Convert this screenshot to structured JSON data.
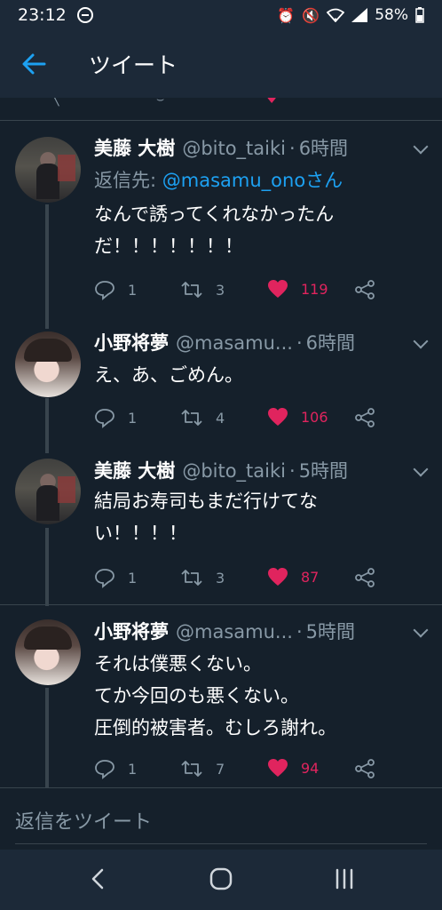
{
  "status_bar": {
    "time": "23:12",
    "battery": "58%"
  },
  "app_bar": {
    "title": "ツイート"
  },
  "tweets": [
    {
      "name": "美藤 大樹",
      "handle": "@bito_taiki",
      "time": "6時間",
      "reply_to_label": "返信先: ",
      "reply_to_mention": "@masamu_onoさん",
      "text_lines": [
        "なんで誘ってくれなかったん",
        "だ！！！！！！！"
      ],
      "replies": "1",
      "retweets": "3",
      "likes": "119"
    },
    {
      "name": "小野将夢",
      "handle": "@masamu...",
      "time": "6時間",
      "text_lines": [
        "え、あ、ごめん。"
      ],
      "replies": "1",
      "retweets": "4",
      "likes": "106"
    },
    {
      "name": "美藤 大樹",
      "handle": "@bito_taiki",
      "time": "5時間",
      "text_lines": [
        "結局お寿司もまだ行けてな",
        "い！！！！"
      ],
      "replies": "1",
      "retweets": "3",
      "likes": "87"
    },
    {
      "name": "小野将夢",
      "handle": "@masamu...",
      "time": "5時間",
      "text_lines": [
        "それは僕悪くない。",
        "てか今回のも悪くない。",
        "圧倒的被害者。むしろ謝れ。"
      ],
      "replies": "1",
      "retweets": "7",
      "likes": "94"
    }
  ],
  "composer": {
    "placeholder": "返信をツイート"
  },
  "colors": {
    "background": "#15202b",
    "bar": "#1c2938",
    "accent": "#1da1f2",
    "like": "#e0245e",
    "secondary_text": "#8899a6"
  },
  "icons": [
    "back-arrow-icon",
    "reply-icon",
    "retweet-icon",
    "heart-icon",
    "share-icon",
    "chevron-down-icon",
    "nav-back-icon",
    "nav-home-icon",
    "nav-recents-icon"
  ]
}
